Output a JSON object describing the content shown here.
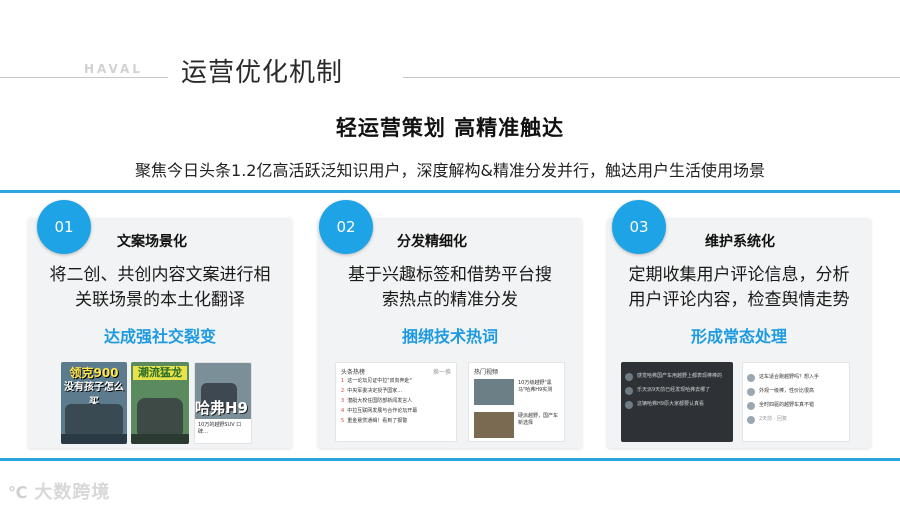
{
  "header": {
    "brand": "HAVAL",
    "title": "运营优化机制"
  },
  "headline": "轻运营策划  高精准触达",
  "subline": "聚焦今日头条1.2亿高活跃泛知识用户，深度解构&精准分发并行，触达用户生活使用场景",
  "cards": [
    {
      "number": "01",
      "title": "文案场景化",
      "desc_line1": "将二创、共创内容文案进行相",
      "desc_line2": "关联场景的本土化翻译",
      "result": "达成强社交裂变",
      "thumbs": {
        "video1_caption1": "领克900",
        "video1_caption2": "没有孩子怎么买",
        "video2_caption": "潮流猛龙",
        "h9_caption": "哈弗H9",
        "h9_text": "10万的越野SUV 口碑…"
      }
    },
    {
      "number": "02",
      "title": "分发精细化",
      "desc_line1": "基于兴趣标签和借势平台搜",
      "desc_line2": "索热点的精准分发",
      "result": "捆绑技术热词",
      "thumbs": {
        "list_header": "头条热榜",
        "list_more": "换一换",
        "list_rows": [
          "这一论坛见证中拉\"双向奔赴\"",
          "中央军委决定授予国家…",
          "潜艇大校任国防部新闻发言人",
          "中拉互联网发展与合作论坛开幕",
          "重金悬赏通缉！看到了报警"
        ],
        "news_header": "热门视频",
        "news_rows": [
          "10万级越野\"黑马\"哈弗H9实测",
          "硬派越野，国产车新选择"
        ]
      }
    },
    {
      "number": "03",
      "title": "维护系统化",
      "desc_line1": "定期收集用户评论信息，分析",
      "desc_line2": "用户评论内容，检查舆情走势",
      "result": "形成常态处理",
      "thumbs": {
        "dark_rows": [
          "感觉哈弗国产车用越野上都表现棒棒的",
          "乐天派9天前已经发现哈弗去哪了",
          "这辆哈弗H9原大家都要认真看"
        ],
        "light_rows": [
          "这车适合跑越野吗？想入手",
          "外观一级棒，性价比很高",
          "全时四驱的越野车真不错"
        ],
        "light_meta": "2天前 · 回复"
      }
    }
  ],
  "footer": {
    "logo_mark": "℃",
    "logo_text": "大数跨境"
  }
}
